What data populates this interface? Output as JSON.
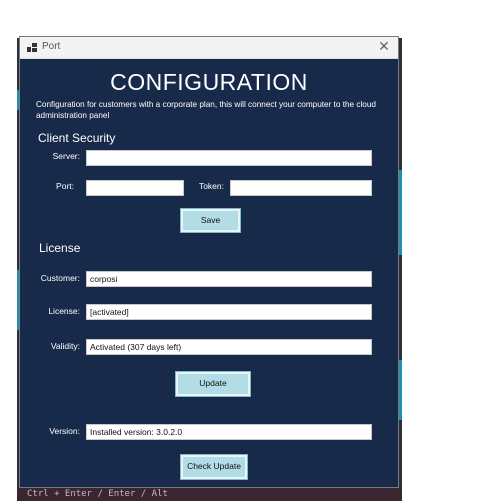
{
  "window": {
    "title": "Port",
    "close_glyph": "✕"
  },
  "header": {
    "title": "CONFIGURATION",
    "description": "Configuration for customers with a corporate plan, this will connect your computer to the cloud administration panel"
  },
  "client_security": {
    "section_title": "Client Security",
    "server_label": "Server:",
    "server_value": "",
    "port_label": "Port:",
    "port_value": "",
    "token_label": "Token:",
    "token_value": "",
    "save_label": "Save"
  },
  "license": {
    "section_title": "License",
    "customer_label": "Customer:",
    "customer_value": "corposi",
    "license_label": "License:",
    "license_value": "[activated]",
    "validity_label": "Validity:",
    "validity_value": "Activated (307 days left)",
    "update_label": "Update"
  },
  "version": {
    "version_label": "Version:",
    "version_value": "Installed version: 3.0.2.0",
    "check_update_label": "Check Update"
  },
  "background": {
    "status_text": "Ctrl + Enter / Enter / Alt"
  },
  "colors": {
    "dialog_bg": "#172a4a",
    "button_bg": "#b3dde6",
    "accent_strip": "#1e8fb0"
  }
}
